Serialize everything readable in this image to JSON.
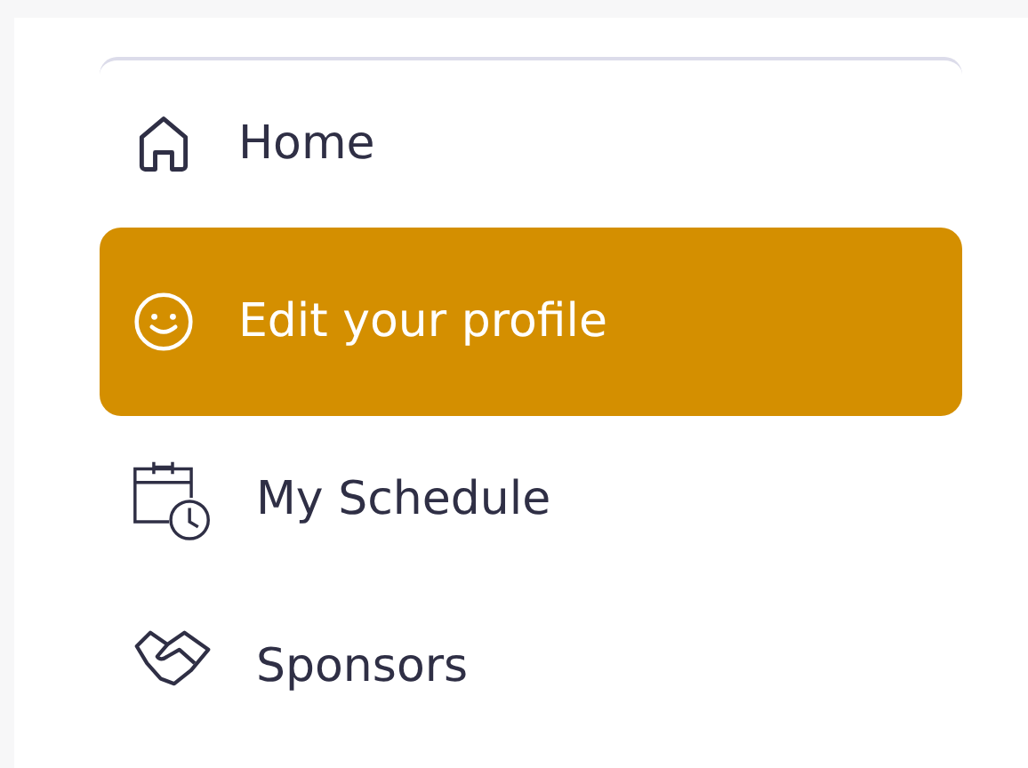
{
  "menu": {
    "items": [
      {
        "label": "Home",
        "kind": "house",
        "selected": false
      },
      {
        "label": "Edit your profile",
        "kind": "smiley",
        "selected": true
      },
      {
        "label": "My Schedule",
        "kind": "calendar",
        "selected": false
      },
      {
        "label": "Sponsors",
        "kind": "handshake",
        "selected": false
      }
    ]
  }
}
